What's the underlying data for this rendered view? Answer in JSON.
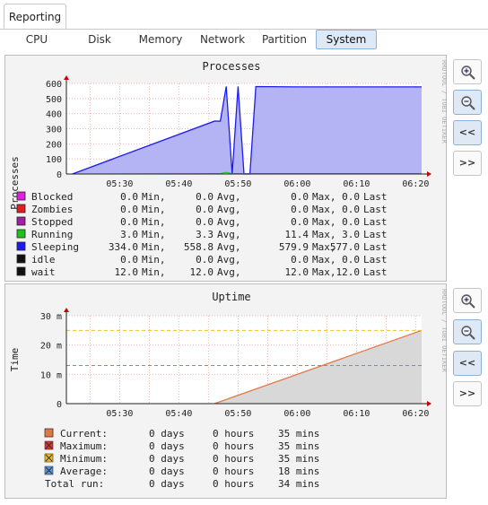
{
  "main_tab": {
    "label": "Reporting"
  },
  "sub_tabs": [
    {
      "label": "CPU",
      "active": false
    },
    {
      "label": "Disk",
      "active": false
    },
    {
      "label": "Memory",
      "active": false
    },
    {
      "label": "Network",
      "active": false
    },
    {
      "label": "Partition",
      "active": false
    },
    {
      "label": "System",
      "active": true
    }
  ],
  "toolbar": {
    "zoom_in_icon": "magnifier-plus-icon",
    "zoom_out_icon": "magnifier-minus-icon",
    "back_label": "<<",
    "forward_label": ">>"
  },
  "watermark": "RRDTOOL / TOBI OETIKER",
  "time_ticks": [
    "05:30",
    "05:40",
    "05:50",
    "06:00",
    "06:10",
    "06:20"
  ],
  "processes": {
    "title": "Processes",
    "ylabel": "Processes",
    "y_ticks": [
      "600",
      "500",
      "400",
      "300",
      "200",
      "100",
      "0"
    ],
    "legend": [
      {
        "name": "Blocked",
        "min": "0.0",
        "avg": "0.0",
        "max": "0.0",
        "last": "0.0",
        "color": "#e020e0",
        "min_unit": "Min,",
        "avg_unit": "Avg,",
        "max_unit": "Max,",
        "last_unit": "Last"
      },
      {
        "name": "Zombies",
        "min": "0.0",
        "avg": "0.0",
        "max": "0.0",
        "last": "0.0",
        "color": "#e02020",
        "min_unit": "Min,",
        "avg_unit": "Avg,",
        "max_unit": "Max,",
        "last_unit": "Last"
      },
      {
        "name": "Stopped",
        "min": "0.0",
        "avg": "0.0",
        "max": "0.0",
        "last": "0.0",
        "color": "#a020a0",
        "min_unit": "Min,",
        "avg_unit": "Avg,",
        "max_unit": "Max,",
        "last_unit": "Last"
      },
      {
        "name": "Running",
        "min": "3.0",
        "avg": "3.3",
        "max": "11.4",
        "last": "3.0",
        "color": "#20c020",
        "min_unit": "Min,",
        "avg_unit": "Avg,",
        "max_unit": "Max,",
        "last_unit": "Last"
      },
      {
        "name": "Sleeping",
        "min": "334.0",
        "avg": "558.8",
        "max": "579.9",
        "last": "577.0",
        "color": "#1c1cf0",
        "min_unit": "Min,",
        "avg_unit": "Avg,",
        "max_unit": "Max,",
        "last_unit": "Last"
      },
      {
        "name": "idle",
        "min": "0.0",
        "avg": "0.0",
        "max": "0.0",
        "last": "0.0",
        "color": "#111111",
        "min_unit": "Min,",
        "avg_unit": "Avg,",
        "max_unit": "Max,",
        "last_unit": "Last"
      },
      {
        "name": "wait",
        "min": "12.0",
        "avg": "12.0",
        "max": "12.0",
        "last": "12.0",
        "color": "#111111",
        "min_unit": "Min,",
        "avg_unit": "Avg,",
        "max_unit": "Max,",
        "last_unit": "Last"
      }
    ]
  },
  "uptime": {
    "title": "Uptime",
    "ylabel": "Time",
    "y_ticks": [
      "30 m",
      "20 m",
      "10 m",
      "0"
    ],
    "legend": [
      {
        "name": "Current:",
        "days": "0 days",
        "hours": "0 hours",
        "mins": "35 mins",
        "color": "#e07840",
        "marker": "square"
      },
      {
        "name": "Maximum:",
        "days": "0 days",
        "hours": "0 hours",
        "mins": "35 mins",
        "color": "#e03030",
        "marker": "cross"
      },
      {
        "name": "Minimum:",
        "days": "0 days",
        "hours": "0 hours",
        "mins": "35 mins",
        "color": "#f0c020",
        "marker": "cross"
      },
      {
        "name": "Average:",
        "days": "0 days",
        "hours": "0 hours",
        "mins": "18 mins",
        "color": "#5a96d8",
        "marker": "cross"
      },
      {
        "name": "Total run:",
        "days": "0 days",
        "hours": "0 hours",
        "mins": "34 mins",
        "color": "",
        "marker": "none"
      }
    ]
  },
  "chart_data": [
    {
      "type": "area",
      "title": "Processes",
      "ylabel": "Processes",
      "ylim": [
        0,
        600
      ],
      "x": [
        "05:22",
        "05:46",
        "05:47",
        "05:48",
        "05:49",
        "05:50",
        "05:51",
        "05:52",
        "05:53",
        "06:00",
        "06:10",
        "06:21"
      ],
      "series": [
        {
          "name": "Sleeping",
          "values": [
            0,
            350,
            350,
            580,
            0,
            580,
            0,
            0,
            579,
            577,
            577,
            577
          ]
        },
        {
          "name": "Running",
          "values": [
            0,
            3,
            3,
            11,
            3,
            3,
            3,
            3,
            3,
            3,
            3,
            3
          ]
        }
      ]
    },
    {
      "type": "area",
      "title": "Uptime",
      "ylabel": "Time",
      "ylim": [
        0,
        30
      ],
      "x": [
        "05:46",
        "06:21"
      ],
      "series": [
        {
          "name": "Current",
          "values": [
            0,
            25
          ]
        },
        {
          "name": "Minimum",
          "values": [
            25,
            25
          ]
        },
        {
          "name": "Average",
          "values": [
            13,
            13
          ]
        }
      ]
    }
  ]
}
